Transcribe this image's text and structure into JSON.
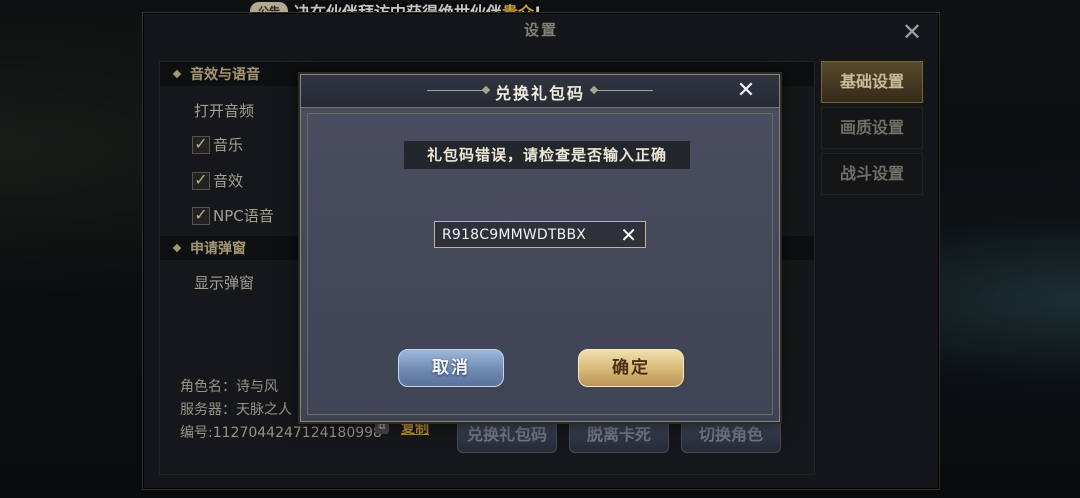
{
  "announcement": {
    "badge": "公告",
    "text_prefix": "决在伙伴拜访中获得绝世伙伴",
    "highlight": "贵介",
    "text_suffix": "!"
  },
  "settings": {
    "title": "设置",
    "section_audio": "音效与语音",
    "open_audio_label": "打开音频",
    "checkboxes": [
      {
        "label": "音乐",
        "checked": true
      },
      {
        "label": "音效",
        "checked": true
      },
      {
        "label": "NPC语音",
        "checked": true
      }
    ],
    "section_popup": "申请弹窗",
    "show_popup_label": "显示弹窗",
    "character_line": "角色名：诗与风",
    "server_line": "服务器：天脉之人",
    "id_line": "编号:1127044247124180998",
    "copy_label": "复制",
    "bottom_buttons": [
      "兑换礼包码",
      "脱离卡死",
      "切换角色"
    ],
    "tabs": [
      {
        "label": "基础设置",
        "active": true
      },
      {
        "label": "画质设置",
        "active": false
      },
      {
        "label": "战斗设置",
        "active": false
      }
    ]
  },
  "modal": {
    "title": "兑换礼包码",
    "error": "礼包码错误，请检查是否输入正确",
    "code_value": "R918C9MMWDTBBX",
    "cancel_label": "取消",
    "confirm_label": "确定"
  },
  "colors": {
    "accent_gold": "#c9b98d",
    "confirm_button": "#d7b877",
    "cancel_button": "#6f8ab2"
  }
}
